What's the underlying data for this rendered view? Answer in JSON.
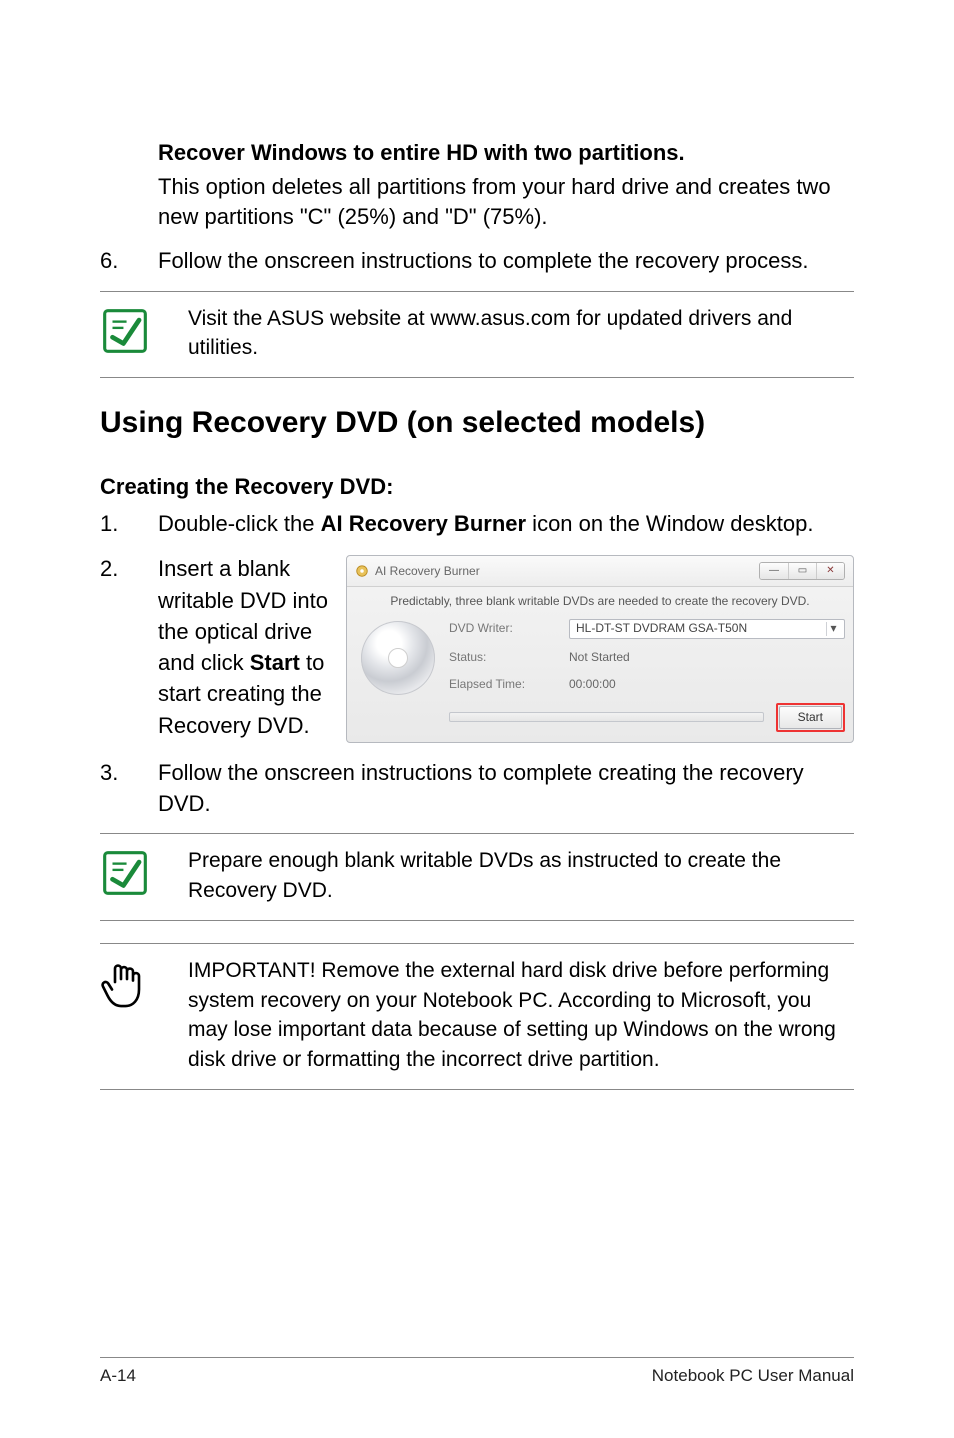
{
  "option": {
    "title": "Recover Windows to entire HD with two partitions.",
    "desc": "This option deletes all partitions from your hard drive and creates two new partitions \"C\" (25%) and \"D\" (75%)."
  },
  "steps_top": {
    "s6_num": "6.",
    "s6_text": "Follow the onscreen instructions to complete the recovery process."
  },
  "note1": "Visit the ASUS website at www.asus.com for updated drivers and utilities.",
  "section_title": "Using Recovery DVD (on selected models)",
  "subsection_title": "Creating the Recovery DVD:",
  "steps_dvd": {
    "s1_num": "1.",
    "s1_pre": "Double-click the ",
    "s1_bold": "AI Recovery Burner",
    "s1_post": " icon on the Window desktop.",
    "s2_num": "2.",
    "s2_pre": "Insert a blank writable DVD into the optical drive and click ",
    "s2_bold": "Start",
    "s2_post": " to start creating the Recovery DVD.",
    "s3_num": "3.",
    "s3_text": "Follow the onscreen instructions to complete creating the recovery DVD."
  },
  "note2": "Prepare enough blank writable DVDs as instructed to create the Recovery DVD.",
  "important": "IMPORTANT! Remove the external hard disk drive before performing system recovery on your Notebook PC. According to Microsoft, you may lose important data because of setting up Windows on the wrong disk drive or formatting the incorrect drive partition.",
  "app": {
    "title": "AI Recovery Burner",
    "hint": "Predictably, three blank writable DVDs are needed to create the recovery DVD.",
    "labels": {
      "writer": "DVD Writer:",
      "status": "Status:",
      "elapsed": "Elapsed Time:"
    },
    "values": {
      "writer": "HL-DT-ST DVDRAM GSA-T50N",
      "status": "Not Started",
      "elapsed": "00:00:00"
    },
    "start_label": "Start"
  },
  "footer": {
    "left": "A-14",
    "right": "Notebook PC User Manual"
  }
}
